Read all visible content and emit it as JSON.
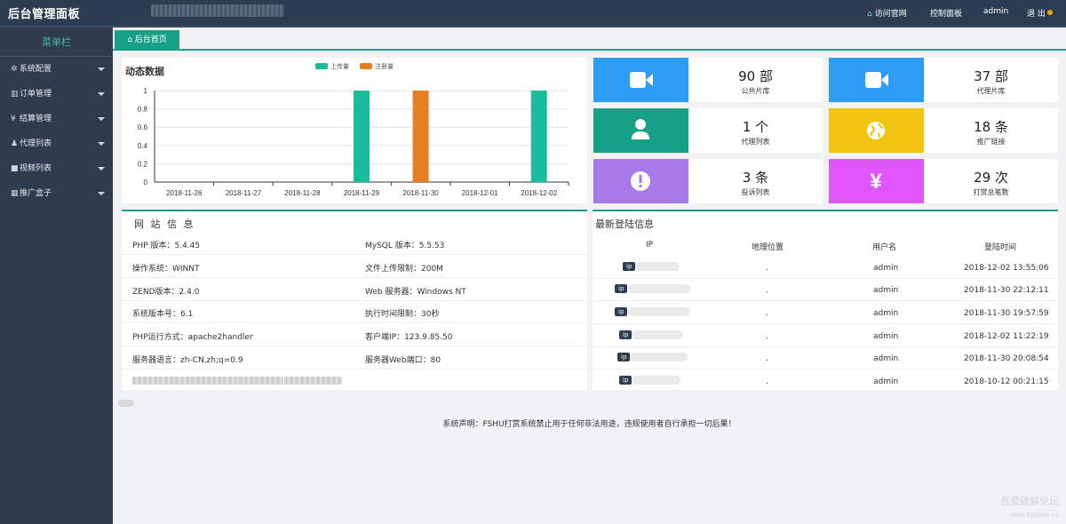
{
  "header": {
    "logo": "后台管理面板",
    "nav": [
      "访问官网",
      "控制面板",
      "admin",
      "退 出"
    ]
  },
  "sidebar": {
    "title": "菜单栏",
    "items": [
      {
        "label": "系统配置",
        "icon": "gear-icon"
      },
      {
        "label": "订单管理",
        "icon": "bar-chart-icon"
      },
      {
        "label": "结算管理",
        "icon": "yen-icon"
      },
      {
        "label": "代理列表",
        "icon": "user-icon"
      },
      {
        "label": "视频列表",
        "icon": "video-icon"
      },
      {
        "label": "推广盒子",
        "icon": "grid-icon"
      }
    ]
  },
  "tab": {
    "label": "后台首页"
  },
  "chart_data": {
    "type": "bar",
    "title": "动态数据",
    "categories": [
      "2018-11-26",
      "2018-11-27",
      "2018-11-28",
      "2018-11-29",
      "2018-11-30",
      "2018-12-01",
      "2018-12-02"
    ],
    "series": [
      {
        "name": "上传量",
        "color": "#1abc9c",
        "values": [
          0,
          0,
          0,
          1,
          0,
          0,
          1
        ]
      },
      {
        "name": "注册量",
        "color": "#e67e22",
        "values": [
          0,
          0,
          0,
          0,
          1,
          0,
          0
        ]
      }
    ],
    "ylim": [
      0,
      1
    ],
    "yticks": [
      "0",
      "0.2",
      "0.4",
      "0.6",
      "0.8",
      "1"
    ],
    "legend": "top-center",
    "grid": true
  },
  "stats": [
    {
      "num": "90 部",
      "label": "公共片库",
      "color": "#2d9cf5",
      "icon": "video-camera-icon"
    },
    {
      "num": "37 部",
      "label": "代理片库",
      "color": "#2d9cf5",
      "icon": "video-camera-icon"
    },
    {
      "num": "1 个",
      "label": "代理列表",
      "color": "#16a085",
      "icon": "user-icon"
    },
    {
      "num": "18 条",
      "label": "推广链接",
      "color": "#f1c40f",
      "icon": "globe-icon"
    },
    {
      "num": "3 条",
      "label": "投诉列表",
      "color": "#a779e9",
      "icon": "alert-icon"
    },
    {
      "num": "29 次",
      "label": "打赏总笔数",
      "color": "#e056fd",
      "icon": "yen-icon"
    }
  ],
  "site_info": {
    "title": "网 站 信 息",
    "rows": [
      [
        "PHP 版本：5.4.45",
        "MySQL 版本：5.5.53"
      ],
      [
        "操作系统：WINNT",
        "文件上传限制：200M"
      ],
      [
        "ZEND版本：2.4.0",
        "Web 服务器：Windows NT"
      ],
      [
        "系统版本号：6.1",
        "执行时间限制：30秒"
      ],
      [
        "PHP运行方式：apache2handler",
        "客户端IP：123.9.85.50"
      ],
      [
        "服务器语言：zh-CN,zh;q=0.9",
        "服务器Web端口：80"
      ]
    ]
  },
  "login_info": {
    "title": "最新登陆信息",
    "headers": [
      "IP",
      "地理位置",
      "用户名",
      "登陆时间"
    ],
    "badge": "ip",
    "rows": [
      {
        "loc": ".",
        "user": "admin",
        "time": "2018-12-02 13:55:06"
      },
      {
        "loc": ".",
        "user": "admin",
        "time": "2018-11-30 22:12:11"
      },
      {
        "loc": ".",
        "user": "admin",
        "time": "2018-11-30 19:57:59"
      },
      {
        "loc": ".",
        "user": "admin",
        "time": "2018-12-02 11:22:19"
      },
      {
        "loc": ".",
        "user": "admin",
        "time": "2018-11-30 20:08:54"
      },
      {
        "loc": ".",
        "user": "admin",
        "time": "2018-10-12 00:21:15"
      }
    ]
  },
  "footer": "系统声明：FSHU打赏系统禁止用于任何非法用途，违规使用者自行承担一切后果！",
  "watermark": {
    "line1": "吾爱破解论坛",
    "line2": "www.52pojie.cn"
  }
}
